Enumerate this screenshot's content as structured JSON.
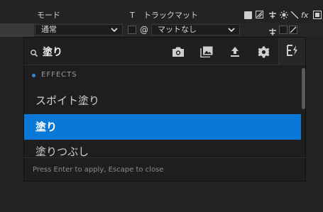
{
  "timeline": {
    "mode_header": "モード",
    "t_header": "T",
    "trackmatte_header": "トラックマット",
    "fx_header": "fx",
    "mode_value": "通常",
    "trackmatte_value": "マットなし",
    "trackmatte_at_symbol": "@"
  },
  "search": {
    "query": "塗り",
    "placeholder": ""
  },
  "toolbar": {
    "icons": [
      "camera-icon",
      "image-icon",
      "upload-icon",
      "gear-icon",
      "effects-icon"
    ]
  },
  "results": {
    "section_label": "EFFECTS",
    "items": [
      {
        "label": "スポイト塗り",
        "selected": false
      },
      {
        "label": "塗り",
        "selected": true
      },
      {
        "label": "塗りつぶし",
        "selected": false
      }
    ]
  },
  "footer": {
    "hint": "Press Enter to apply, Escape to close"
  },
  "colors": {
    "accent": "#0a78d7",
    "section_dot": "#2e8ce0"
  }
}
